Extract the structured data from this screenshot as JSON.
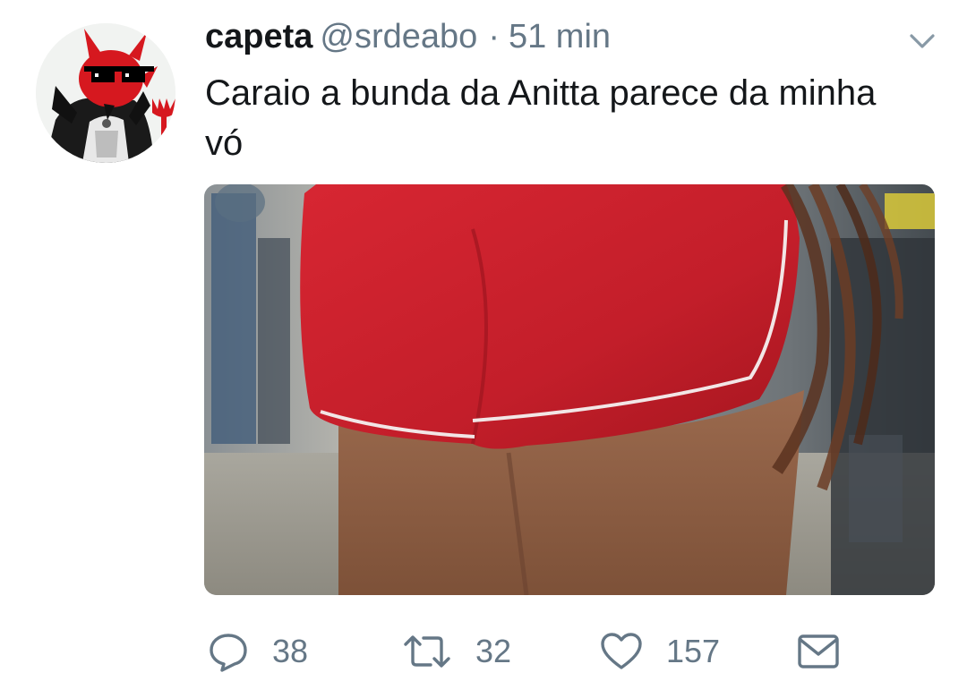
{
  "tweet": {
    "display_name": "capeta",
    "handle": "@srdeabo",
    "separator": "·",
    "time": "51 min",
    "text": "Caraio a bunda da Anitta parece da minha vó",
    "avatar_icon": "devil-avatar",
    "menu_icon": "chevron-down-icon",
    "media_alt": "photo"
  },
  "actions": {
    "reply": {
      "icon": "reply-icon",
      "count": "38"
    },
    "retweet": {
      "icon": "retweet-icon",
      "count": "32"
    },
    "like": {
      "icon": "heart-icon",
      "count": "157"
    },
    "dm": {
      "icon": "envelope-icon"
    }
  },
  "colors": {
    "text": "#14171a",
    "secondary": "#657786",
    "shorts_red": "#c8202b",
    "background": "#ffffff"
  }
}
